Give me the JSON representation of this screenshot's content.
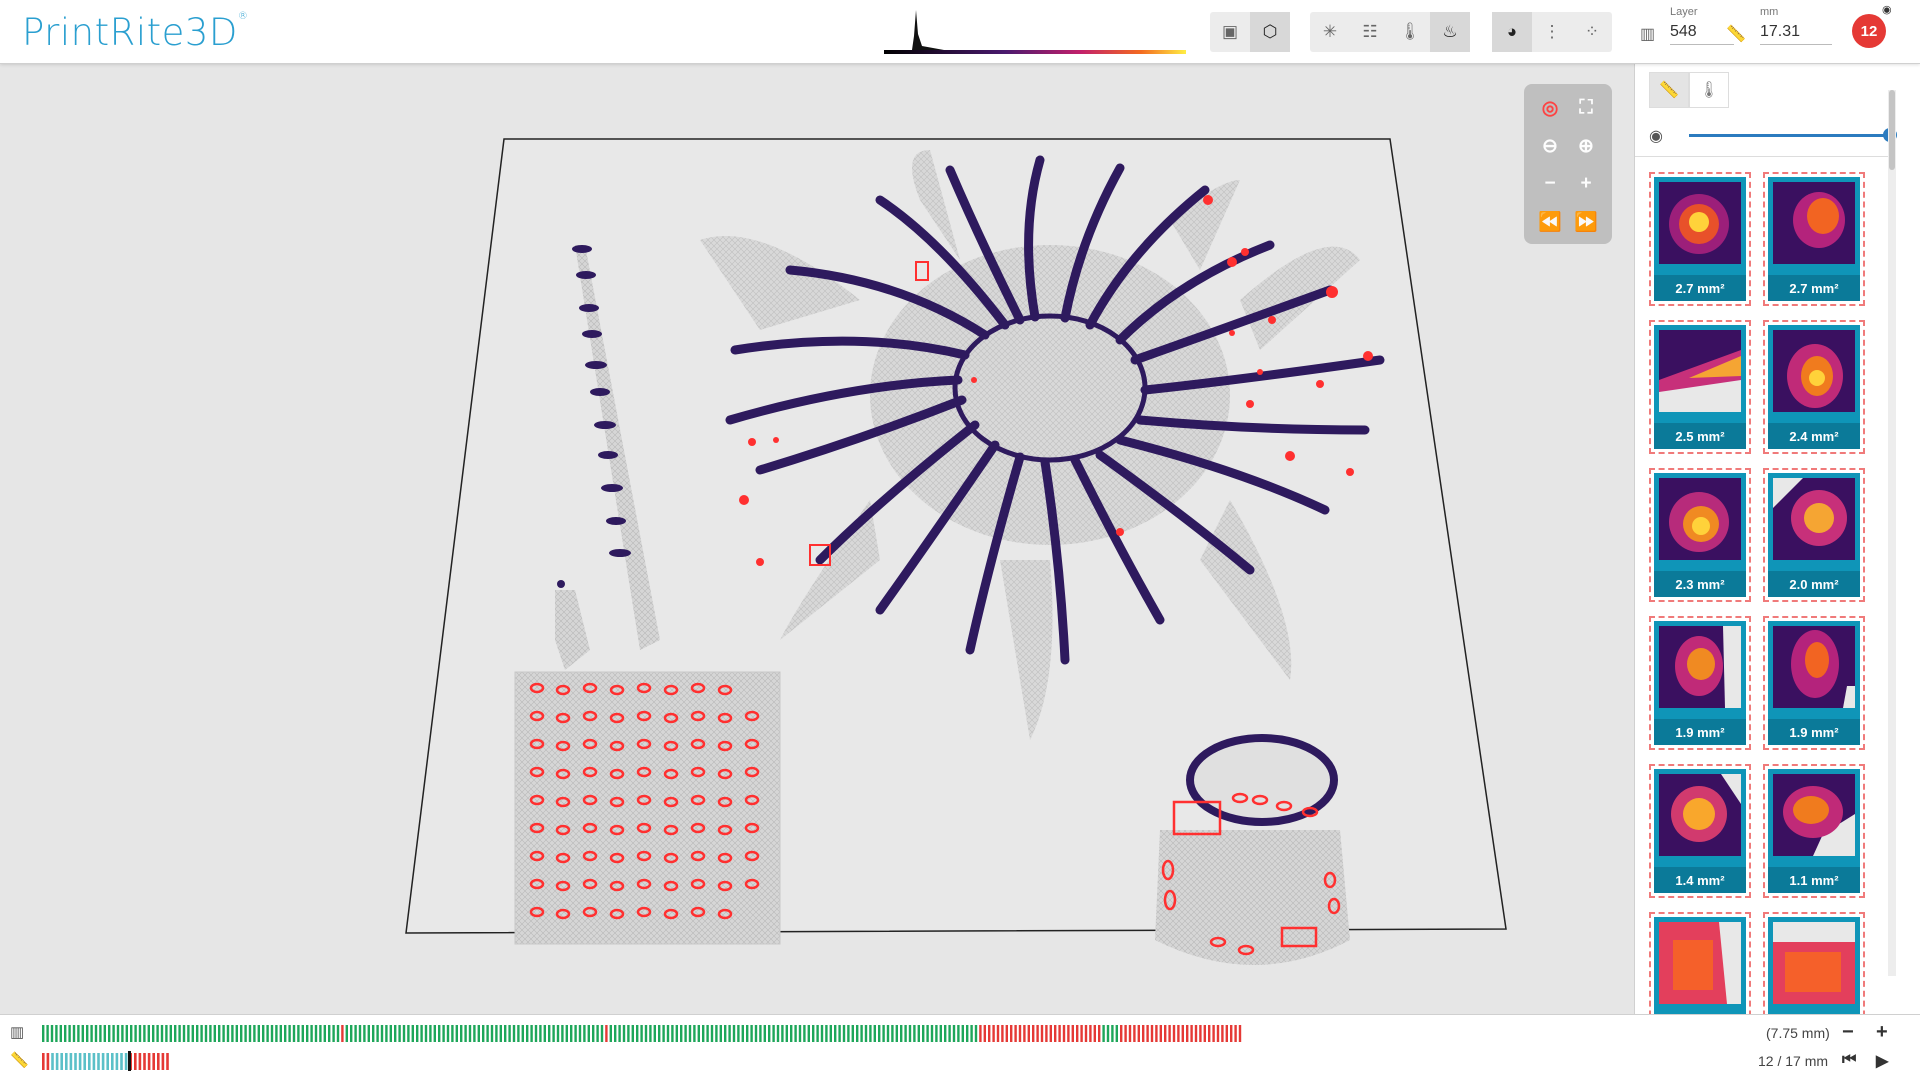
{
  "app": {
    "logo": "PrintRite3D",
    "logo_mark": "®"
  },
  "header": {
    "layer_label": "Layer",
    "layer_value": "548",
    "mm_label": "mm",
    "mm_value": "17.31",
    "notification_count": "12"
  },
  "view_icons": [
    "image-icon",
    "cube-icon"
  ],
  "analysis_icons": [
    "crosshair-icon",
    "grid-icon",
    "thermometer-icon",
    "heat-sensor-icon"
  ],
  "overlay_icons": [
    "palette-icon",
    "vertical-dots-icon",
    "scatter-icon"
  ],
  "thumbnails": [
    {
      "label": "2.7 mm²"
    },
    {
      "label": "2.7 mm²"
    },
    {
      "label": "2.5 mm²"
    },
    {
      "label": "2.4 mm²"
    },
    {
      "label": "2.3 mm²"
    },
    {
      "label": "2.0 mm²"
    },
    {
      "label": "1.9 mm²"
    },
    {
      "label": "1.9 mm²"
    },
    {
      "label": "1.4 mm²"
    },
    {
      "label": "1.1 mm²"
    },
    {
      "label": ""
    },
    {
      "label": ""
    }
  ],
  "footer": {
    "height_value": "(7.75 mm)",
    "page_value": "12 / 17 mm"
  },
  "colors": {
    "accent": "#2a9fd0",
    "ok": "#1ea65a",
    "fail": "#e53935",
    "highlight": "#5bc0c8",
    "part_stroke": "#2e1a5e"
  }
}
